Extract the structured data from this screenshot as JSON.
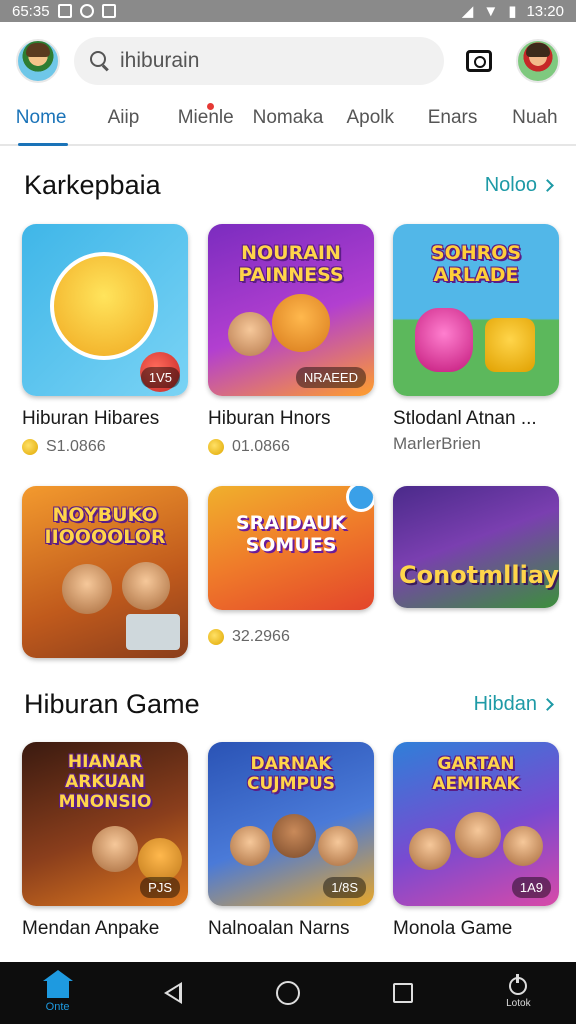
{
  "status_bar": {
    "left_text": "65:35",
    "time": "13:20"
  },
  "header": {
    "search_placeholder": "ihiburain",
    "camera_icon": "camera-icon",
    "avatar_left": "user-avatar",
    "avatar_right": "profile-avatar"
  },
  "tabs": [
    {
      "label": "Nome",
      "active": true
    },
    {
      "label": "Aiip"
    },
    {
      "label": "Mienle",
      "dot": true
    },
    {
      "label": "Nomaka"
    },
    {
      "label": "Apolk"
    },
    {
      "label": "Enars"
    },
    {
      "label": "Nuah"
    }
  ],
  "section1": {
    "title": "Karkepbaia",
    "more": "Noloo",
    "cards": [
      {
        "art": "",
        "badge": "1V5",
        "title": "Hiburan Hibares",
        "meta": "S1.0866",
        "colors": [
          "#3fb6e8",
          "#f6d23a"
        ]
      },
      {
        "art": "NOURAIN PAINNESS",
        "badge": "NRAEED",
        "title": "Hiburan Hnors",
        "meta": "01.0866",
        "colors": [
          "#7b2cbf",
          "#ff9e2c"
        ]
      },
      {
        "art": "SOHROS ARLADE",
        "badge": "",
        "title": "Stlodanl Atnan ...",
        "sub": "MarlerBrien",
        "meta": "",
        "colors": [
          "#52b7e8",
          "#5cb85c"
        ]
      },
      {
        "art": "NOYBUKO IIOOOOLOR",
        "badge": "",
        "title": "",
        "meta": "",
        "colors": [
          "#f39a2e",
          "#8a3e1c"
        ]
      },
      {
        "art": "SRAIDAUK SOMUES",
        "badge": "",
        "title": "",
        "meta": "32.2966",
        "colors": [
          "#f0b02d",
          "#e3452b"
        ]
      },
      {
        "art": "Conotmlliay",
        "badge": "",
        "title": "",
        "meta": "",
        "colors": [
          "#4a2a8a",
          "#3c8f3c"
        ]
      }
    ]
  },
  "section2": {
    "title": "Hiburan Game",
    "more": "Hibdan",
    "cards": [
      {
        "art": "HIANAR ARKUAN MNONSIO",
        "badge": "PJS",
        "title": "Mendan Anpake",
        "meta": "",
        "colors": [
          "#3a1a10",
          "#e07a1f"
        ]
      },
      {
        "art": "DARNAK CUJMPUS",
        "badge": "1/8S",
        "title": "Nalnoalan Narns",
        "meta": "",
        "colors": [
          "#2a53b5",
          "#e8a72a"
        ]
      },
      {
        "art": "GARTAN AEMIRAK",
        "badge": "1A9",
        "title": "Monola Game",
        "meta": "",
        "colors": [
          "#2f7fd8",
          "#d84aa8"
        ]
      }
    ]
  },
  "nav": {
    "home_label": "Onte",
    "power_label": "Lotok"
  }
}
